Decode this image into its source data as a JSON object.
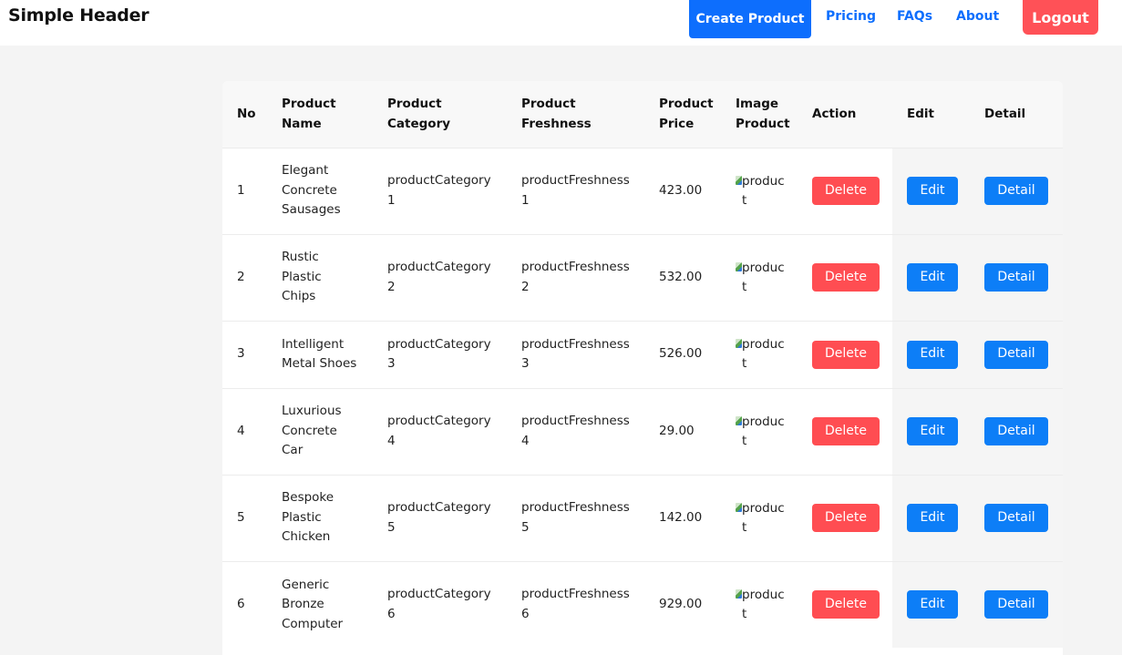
{
  "header": {
    "brand": "Simple Header",
    "create_label": "Create Product",
    "pricing_label": "Pricing",
    "faqs_label": "FAQs",
    "about_label": "About",
    "logout_label": "Logout",
    "colors": {
      "primary": "#0d6efd",
      "danger": "#ff5157"
    }
  },
  "table": {
    "columns": [
      [
        "No"
      ],
      [
        "Product",
        "Name"
      ],
      [
        "Product",
        "Category"
      ],
      [
        "Product",
        "Freshness"
      ],
      [
        "Product",
        "Price"
      ],
      [
        "Image",
        "Product"
      ],
      [
        "Action"
      ],
      [
        "Edit"
      ],
      [
        "Detail"
      ]
    ],
    "rows": [
      {
        "no": "1",
        "name": [
          "Elegant",
          "Concrete",
          "Sausages"
        ],
        "category": [
          "productCategory",
          "1"
        ],
        "freshness": [
          "productFreshness",
          "1"
        ],
        "price": "423.00",
        "image_alt": "product"
      },
      {
        "no": "2",
        "name": [
          "Rustic",
          "Plastic",
          "Chips"
        ],
        "category": [
          "productCategory",
          "2"
        ],
        "freshness": [
          "productFreshness",
          "2"
        ],
        "price": "532.00",
        "image_alt": "product"
      },
      {
        "no": "3",
        "name": [
          "Intelligent",
          "Metal Shoes"
        ],
        "category": [
          "productCategory",
          "3"
        ],
        "freshness": [
          "productFreshness",
          "3"
        ],
        "price": "526.00",
        "image_alt": "product"
      },
      {
        "no": "4",
        "name": [
          "Luxurious",
          "Concrete",
          "Car"
        ],
        "category": [
          "productCategory",
          "4"
        ],
        "freshness": [
          "productFreshness",
          "4"
        ],
        "price": "29.00",
        "image_alt": "product"
      },
      {
        "no": "5",
        "name": [
          "Bespoke",
          "Plastic",
          "Chicken"
        ],
        "category": [
          "productCategory",
          "5"
        ],
        "freshness": [
          "productFreshness",
          "5"
        ],
        "price": "142.00",
        "image_alt": "product"
      },
      {
        "no": "6",
        "name": [
          "Generic",
          "Bronze",
          "Computer"
        ],
        "category": [
          "productCategory",
          "6"
        ],
        "freshness": [
          "productFreshness",
          "6"
        ],
        "price": "929.00",
        "image_alt": "product"
      }
    ],
    "delete_label": "Delete",
    "edit_label": "Edit",
    "detail_label": "Detail",
    "image_icon": "broken-image-icon"
  }
}
